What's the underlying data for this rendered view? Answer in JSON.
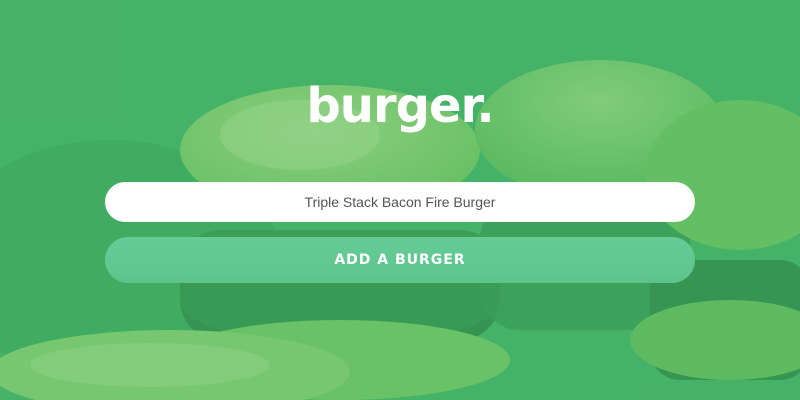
{
  "brand": {
    "logo_text": "burger."
  },
  "form": {
    "input_value": "Triple Stack Bacon Fire Burger",
    "submit_label": "ADD A BURGER"
  },
  "colors": {
    "overlay": "#3cb264",
    "button": "#5fc78f",
    "input_background": "#ffffff",
    "text_light": "#ffffff"
  }
}
